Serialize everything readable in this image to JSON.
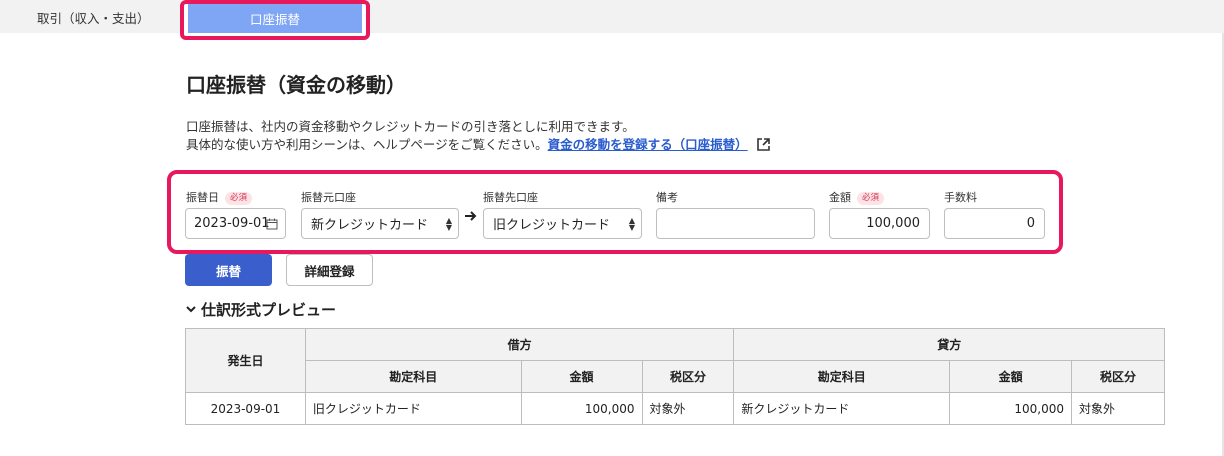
{
  "tabs": {
    "transactions": "取引（収入・支出）",
    "account_transfer": "口座振替"
  },
  "page": {
    "title": "口座振替（資金の移動）",
    "description_line1": "口座振替は、社内の資金移動やクレジットカードの引き落としに利用できます。",
    "description_line2": "具体的な使い方や利用シーンは、ヘルプページをご覧ください。",
    "help_link": "資金の移動を登録する（口座振替）"
  },
  "form": {
    "date_label": "振替日",
    "required_badge": "必須",
    "date_value": "2023-09-01",
    "from_label": "振替元口座",
    "from_value": "新クレジットカード",
    "to_label": "振替先口座",
    "to_value": "旧クレジットカード",
    "memo_label": "備考",
    "memo_value": "",
    "amount_label": "金額",
    "amount_value": "100,000",
    "fee_label": "手数料",
    "fee_value": "0"
  },
  "buttons": {
    "transfer": "振替",
    "detail": "詳細登録"
  },
  "preview": {
    "title": "仕訳形式プレビュー",
    "col_date": "発生日",
    "col_debit": "借方",
    "col_credit": "貸方",
    "col_account": "勘定科目",
    "col_amount": "金額",
    "col_tax": "税区分",
    "row": {
      "date": "2023-09-01",
      "debit_account": "旧クレジットカード",
      "debit_amount": "100,000",
      "debit_tax": "対象外",
      "credit_account": "新クレジットカード",
      "credit_amount": "100,000",
      "credit_tax": "対象外"
    }
  }
}
